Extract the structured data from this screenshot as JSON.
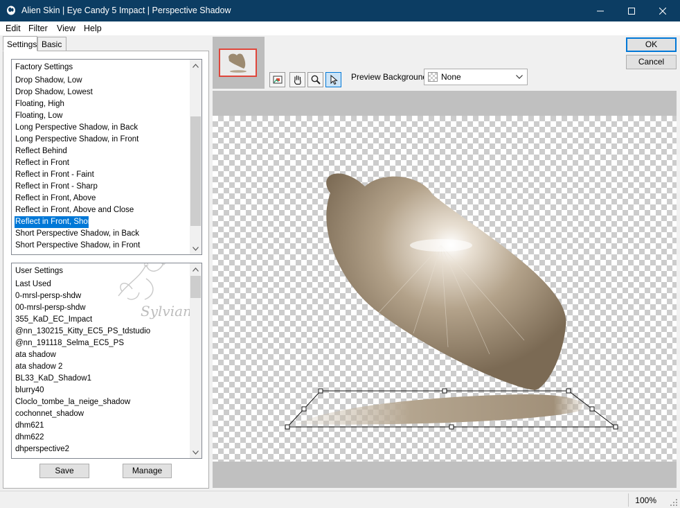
{
  "window": {
    "title": "Alien Skin | Eye Candy 5 Impact | Perspective Shadow",
    "app_icon": "alien-skin-icon"
  },
  "menu": {
    "items": [
      {
        "label": "Edit",
        "name": "menu-edit"
      },
      {
        "label": "Filter",
        "name": "menu-filter"
      },
      {
        "label": "View",
        "name": "menu-view"
      },
      {
        "label": "Help",
        "name": "menu-help"
      }
    ]
  },
  "tabs": [
    "Settings",
    "Basic"
  ],
  "factory_settings": {
    "header": "Factory Settings",
    "selected": "Reflect in Front, Short",
    "items": [
      "Drop Shadow, Low",
      "Drop Shadow, Lowest",
      "Floating, High",
      "Floating, Low",
      "Long Perspective Shadow, in Back",
      "Long Perspective Shadow, in Front",
      "Reflect Behind",
      "Reflect in Front",
      "Reflect in Front - Faint",
      "Reflect in Front - Sharp",
      "Reflect in Front, Above",
      "Reflect in Front, Above and Close",
      "Reflect in Front, Short",
      "Short Perspective Shadow, in Back",
      "Short Perspective Shadow, in Front"
    ]
  },
  "user_settings": {
    "header": "User Settings",
    "items": [
      "Last Used",
      "0-mrsl-persp-shdw",
      "00-mrsl-persp-shdw",
      "355_KaD_EC_Impact",
      "@nn_130215_Kitty_EC5_PS_tdstudio",
      "@nn_191118_Selma_EC5_PS",
      "ata shadow",
      "ata shadow 2",
      "BL33_KaD_Shadow1",
      "blurry40",
      "Cloclo_tombe_la_neige_shadow",
      "cochonnet_shadow",
      "dhm621",
      "dhm622",
      "dhperspective2"
    ],
    "watermark": "Sylviane"
  },
  "buttons": {
    "save": "Save",
    "manage": "Manage",
    "ok": "OK",
    "cancel": "Cancel"
  },
  "tools": [
    {
      "name": "navigator-tool-icon"
    },
    {
      "name": "hand-tool-icon"
    },
    {
      "name": "zoom-tool-icon"
    },
    {
      "name": "pointer-tool-icon",
      "active": true
    }
  ],
  "preview_background": {
    "label": "Preview Background:",
    "value": "None"
  },
  "status": {
    "zoom": "100%"
  },
  "colors": {
    "titlebar": "#0c3d63",
    "selection": "#0078d7",
    "image_tone": "#a8977f",
    "thumbnail_border": "#e0453a"
  }
}
